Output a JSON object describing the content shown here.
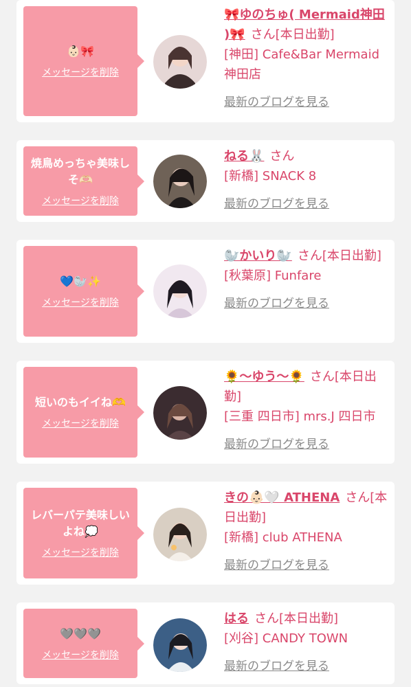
{
  "ui": {
    "delete_label": "メッセージを削除",
    "blog_label": "最新のブログを見る",
    "san_label": "さん"
  },
  "colors": {
    "background": "#f2f2f2",
    "bubble": "#f79ba7",
    "accent_text": "#d9466a",
    "muted_link": "#8a8a8a"
  },
  "items": [
    {
      "message": "👶🏻🎀",
      "name": "🎀ゆのちゅ( Mermaid神田 )🎀",
      "status": "[本日出勤]",
      "shop": "[神田] Cafe&Bar Mermaid 神田店"
    },
    {
      "message": "焼鳥めっちゃ美味しそ🫶🏻",
      "name": "ねる🐰",
      "status": "",
      "shop": "[新橋] SNACK 8"
    },
    {
      "message": "💙🦭✨",
      "name": "🦭かいり🦭",
      "status": "[本日出勤]",
      "shop": "[秋葉原] Funfare"
    },
    {
      "message": "短いのもイイね🫶",
      "name": "🌻〜ゆう〜🌻",
      "status": "[本日出勤]",
      "shop": "[三重 四日市] mrs.J 四日市"
    },
    {
      "message": "レバーパテ美味しいよね💭",
      "name": "きの👶🏻🤍 ATHENA",
      "status": "[本日出勤]",
      "shop": "[新橋] club ATHENA"
    },
    {
      "message": "🩶🩶🩶",
      "name": "はる",
      "status": "[本日出勤]",
      "shop": "[刈谷] CANDY TOWN"
    }
  ]
}
